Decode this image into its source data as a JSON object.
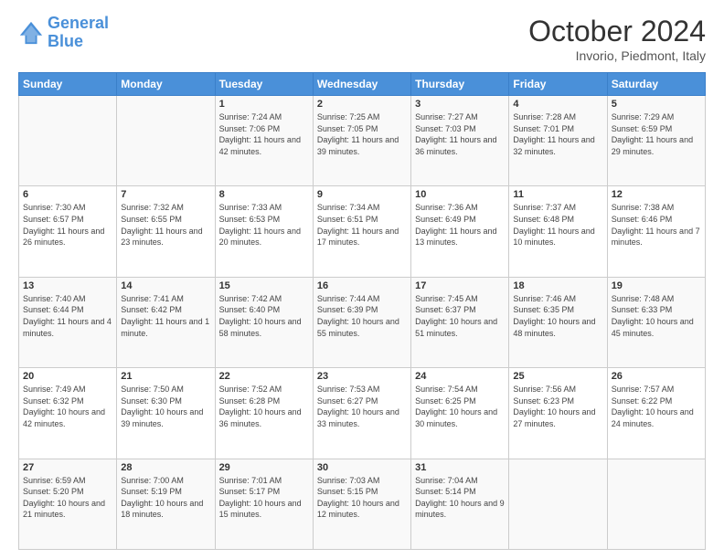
{
  "header": {
    "logo_line1": "General",
    "logo_line2": "Blue",
    "title": "October 2024",
    "subtitle": "Invorio, Piedmont, Italy"
  },
  "days_of_week": [
    "Sunday",
    "Monday",
    "Tuesday",
    "Wednesday",
    "Thursday",
    "Friday",
    "Saturday"
  ],
  "weeks": [
    [
      {
        "day": "",
        "info": ""
      },
      {
        "day": "",
        "info": ""
      },
      {
        "day": "1",
        "info": "Sunrise: 7:24 AM\nSunset: 7:06 PM\nDaylight: 11 hours and 42 minutes."
      },
      {
        "day": "2",
        "info": "Sunrise: 7:25 AM\nSunset: 7:05 PM\nDaylight: 11 hours and 39 minutes."
      },
      {
        "day": "3",
        "info": "Sunrise: 7:27 AM\nSunset: 7:03 PM\nDaylight: 11 hours and 36 minutes."
      },
      {
        "day": "4",
        "info": "Sunrise: 7:28 AM\nSunset: 7:01 PM\nDaylight: 11 hours and 32 minutes."
      },
      {
        "day": "5",
        "info": "Sunrise: 7:29 AM\nSunset: 6:59 PM\nDaylight: 11 hours and 29 minutes."
      }
    ],
    [
      {
        "day": "6",
        "info": "Sunrise: 7:30 AM\nSunset: 6:57 PM\nDaylight: 11 hours and 26 minutes."
      },
      {
        "day": "7",
        "info": "Sunrise: 7:32 AM\nSunset: 6:55 PM\nDaylight: 11 hours and 23 minutes."
      },
      {
        "day": "8",
        "info": "Sunrise: 7:33 AM\nSunset: 6:53 PM\nDaylight: 11 hours and 20 minutes."
      },
      {
        "day": "9",
        "info": "Sunrise: 7:34 AM\nSunset: 6:51 PM\nDaylight: 11 hours and 17 minutes."
      },
      {
        "day": "10",
        "info": "Sunrise: 7:36 AM\nSunset: 6:49 PM\nDaylight: 11 hours and 13 minutes."
      },
      {
        "day": "11",
        "info": "Sunrise: 7:37 AM\nSunset: 6:48 PM\nDaylight: 11 hours and 10 minutes."
      },
      {
        "day": "12",
        "info": "Sunrise: 7:38 AM\nSunset: 6:46 PM\nDaylight: 11 hours and 7 minutes."
      }
    ],
    [
      {
        "day": "13",
        "info": "Sunrise: 7:40 AM\nSunset: 6:44 PM\nDaylight: 11 hours and 4 minutes."
      },
      {
        "day": "14",
        "info": "Sunrise: 7:41 AM\nSunset: 6:42 PM\nDaylight: 11 hours and 1 minute."
      },
      {
        "day": "15",
        "info": "Sunrise: 7:42 AM\nSunset: 6:40 PM\nDaylight: 10 hours and 58 minutes."
      },
      {
        "day": "16",
        "info": "Sunrise: 7:44 AM\nSunset: 6:39 PM\nDaylight: 10 hours and 55 minutes."
      },
      {
        "day": "17",
        "info": "Sunrise: 7:45 AM\nSunset: 6:37 PM\nDaylight: 10 hours and 51 minutes."
      },
      {
        "day": "18",
        "info": "Sunrise: 7:46 AM\nSunset: 6:35 PM\nDaylight: 10 hours and 48 minutes."
      },
      {
        "day": "19",
        "info": "Sunrise: 7:48 AM\nSunset: 6:33 PM\nDaylight: 10 hours and 45 minutes."
      }
    ],
    [
      {
        "day": "20",
        "info": "Sunrise: 7:49 AM\nSunset: 6:32 PM\nDaylight: 10 hours and 42 minutes."
      },
      {
        "day": "21",
        "info": "Sunrise: 7:50 AM\nSunset: 6:30 PM\nDaylight: 10 hours and 39 minutes."
      },
      {
        "day": "22",
        "info": "Sunrise: 7:52 AM\nSunset: 6:28 PM\nDaylight: 10 hours and 36 minutes."
      },
      {
        "day": "23",
        "info": "Sunrise: 7:53 AM\nSunset: 6:27 PM\nDaylight: 10 hours and 33 minutes."
      },
      {
        "day": "24",
        "info": "Sunrise: 7:54 AM\nSunset: 6:25 PM\nDaylight: 10 hours and 30 minutes."
      },
      {
        "day": "25",
        "info": "Sunrise: 7:56 AM\nSunset: 6:23 PM\nDaylight: 10 hours and 27 minutes."
      },
      {
        "day": "26",
        "info": "Sunrise: 7:57 AM\nSunset: 6:22 PM\nDaylight: 10 hours and 24 minutes."
      }
    ],
    [
      {
        "day": "27",
        "info": "Sunrise: 6:59 AM\nSunset: 5:20 PM\nDaylight: 10 hours and 21 minutes."
      },
      {
        "day": "28",
        "info": "Sunrise: 7:00 AM\nSunset: 5:19 PM\nDaylight: 10 hours and 18 minutes."
      },
      {
        "day": "29",
        "info": "Sunrise: 7:01 AM\nSunset: 5:17 PM\nDaylight: 10 hours and 15 minutes."
      },
      {
        "day": "30",
        "info": "Sunrise: 7:03 AM\nSunset: 5:15 PM\nDaylight: 10 hours and 12 minutes."
      },
      {
        "day": "31",
        "info": "Sunrise: 7:04 AM\nSunset: 5:14 PM\nDaylight: 10 hours and 9 minutes."
      },
      {
        "day": "",
        "info": ""
      },
      {
        "day": "",
        "info": ""
      }
    ]
  ]
}
